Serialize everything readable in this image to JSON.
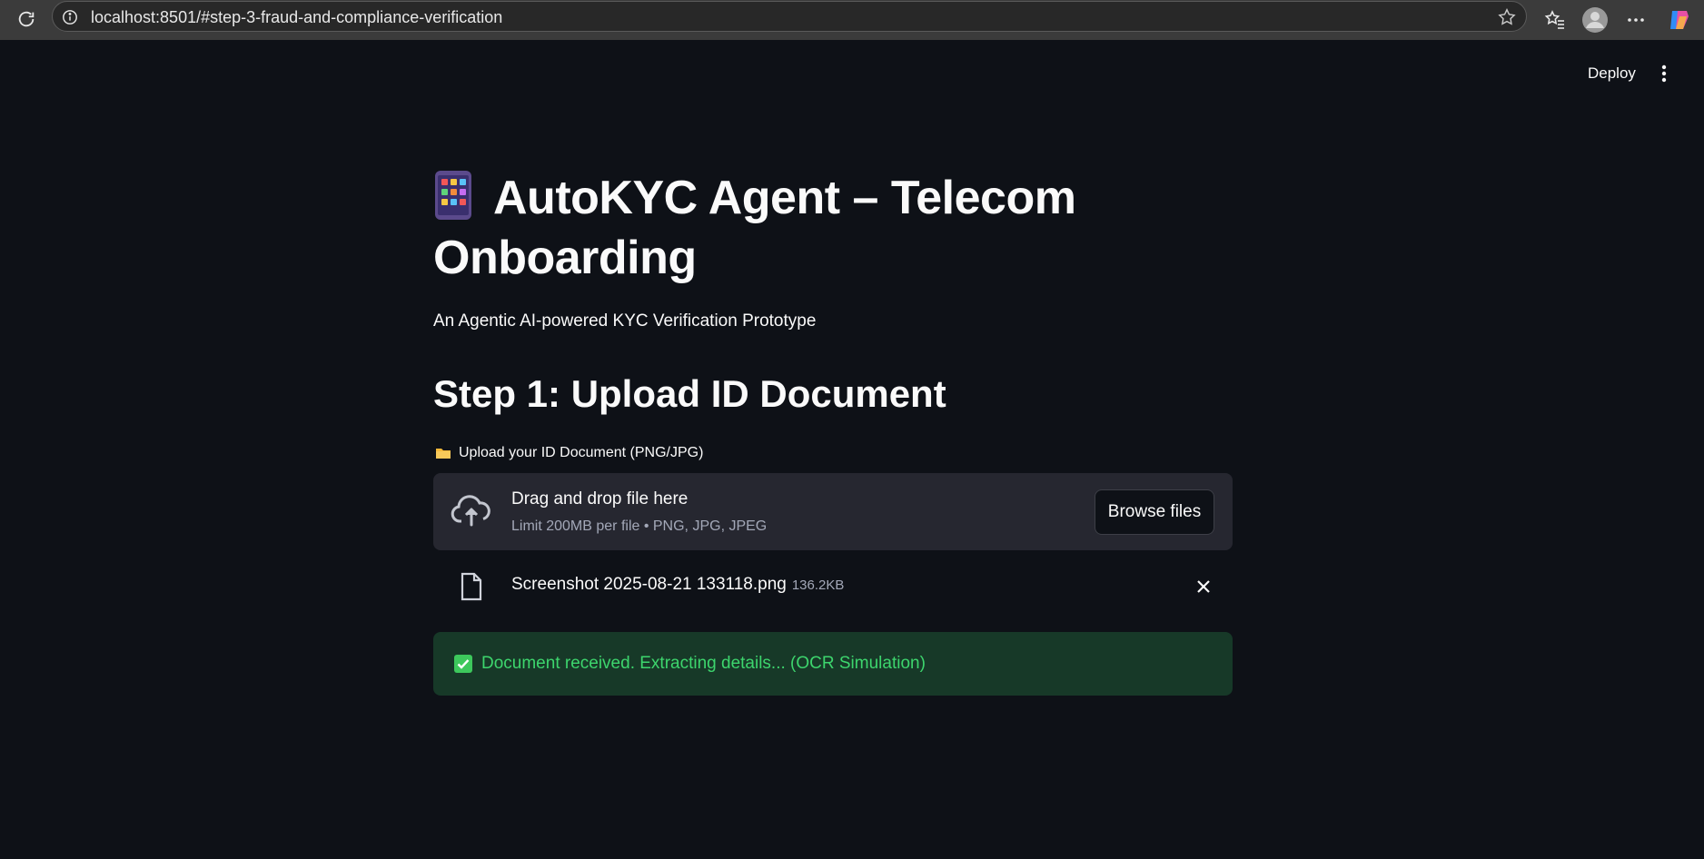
{
  "browser": {
    "url": "localhost:8501/#step-3-fraud-and-compliance-verification"
  },
  "header": {
    "deploy_label": "Deploy"
  },
  "main": {
    "title": "AutoKYC Agent – Telecom Onboarding",
    "subtitle": "An Agentic AI-powered KYC Verification Prototype",
    "step_heading": "Step 1: Upload ID Document",
    "upload_label": "Upload your ID Document (PNG/JPG)",
    "dropzone": {
      "title": "Drag and drop file here",
      "limit_text": "Limit 200MB per file • PNG, JPG, JPEG",
      "browse_label": "Browse files"
    },
    "uploaded_file": {
      "name": "Screenshot 2025-08-21 133118.png",
      "size": "136.2KB"
    },
    "success_message": "Document received. Extracting details... (OCR Simulation)"
  },
  "colors": {
    "background": "#0e1117",
    "dropzone": "#262730",
    "success_bg": "#173928",
    "success_text": "#3dd56d"
  },
  "icons": [
    "reload-icon",
    "info-icon",
    "star-icon",
    "favorites-icon",
    "profile-icon",
    "more-icon",
    "copilot-icon",
    "kebab-menu-icon",
    "mobile-phone-emoji-icon",
    "folder-icon",
    "cloud-upload-icon",
    "file-icon",
    "close-icon",
    "check-mark-icon"
  ]
}
